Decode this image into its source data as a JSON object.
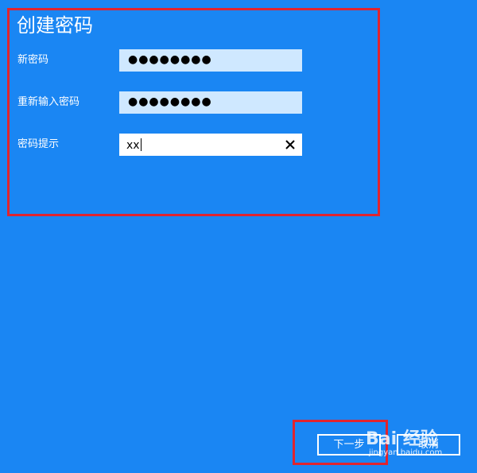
{
  "page": {
    "title": "创建密码",
    "background_color": "#1a86f3",
    "highlight_color": "#e0242f"
  },
  "form": {
    "new_password": {
      "label": "新密码",
      "value_masked": "●●●●●●●●"
    },
    "reenter_password": {
      "label": "重新输入密码",
      "value_masked": "●●●●●●●●"
    },
    "password_hint": {
      "label": "密码提示",
      "value": "xx",
      "clear_icon": "close-icon"
    }
  },
  "buttons": {
    "next_label": "下一步",
    "cancel_label": "取消"
  },
  "watermark": {
    "brand": "Bai 经验",
    "url": "jingyan.baidu.com"
  }
}
